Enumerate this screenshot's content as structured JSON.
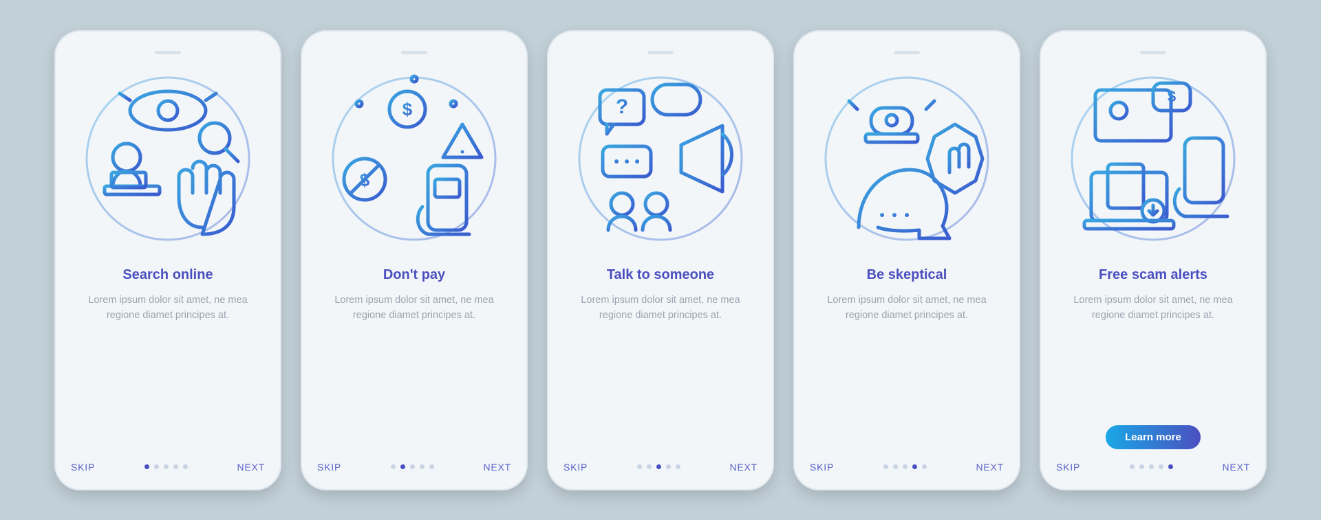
{
  "nav": {
    "skip": "SKIP",
    "next": "NEXT"
  },
  "cta_label": "Learn more",
  "lorem": "Lorem ipsum dolor sit amet, ne mea regione diamet principes at.",
  "colors": {
    "stroke_light": "#3aa6e0",
    "stroke_dark": "#3a5bcf",
    "title": "#4a4fbf"
  },
  "screens": [
    {
      "title": "Search online",
      "body": "Lorem ipsum dolor sit amet, ne mea regione diamet principes at.",
      "icon": "search-online",
      "active_dot": 0,
      "has_cta": false
    },
    {
      "title": "Don't pay",
      "body": "Lorem ipsum dolor sit amet, ne mea regione diamet principes at.",
      "icon": "dont-pay",
      "active_dot": 1,
      "has_cta": false
    },
    {
      "title": "Talk to someone",
      "body": "Lorem ipsum dolor sit amet, ne mea regione diamet principes at.",
      "icon": "talk-to-someone",
      "active_dot": 2,
      "has_cta": false
    },
    {
      "title": "Be skeptical",
      "body": "Lorem ipsum dolor sit amet, ne mea regione diamet principes at.",
      "icon": "be-skeptical",
      "active_dot": 3,
      "has_cta": false
    },
    {
      "title": "Free scam alerts",
      "body": "Lorem ipsum dolor sit amet, ne mea regione diamet principes at.",
      "icon": "free-scam-alerts",
      "active_dot": 4,
      "has_cta": true
    }
  ]
}
